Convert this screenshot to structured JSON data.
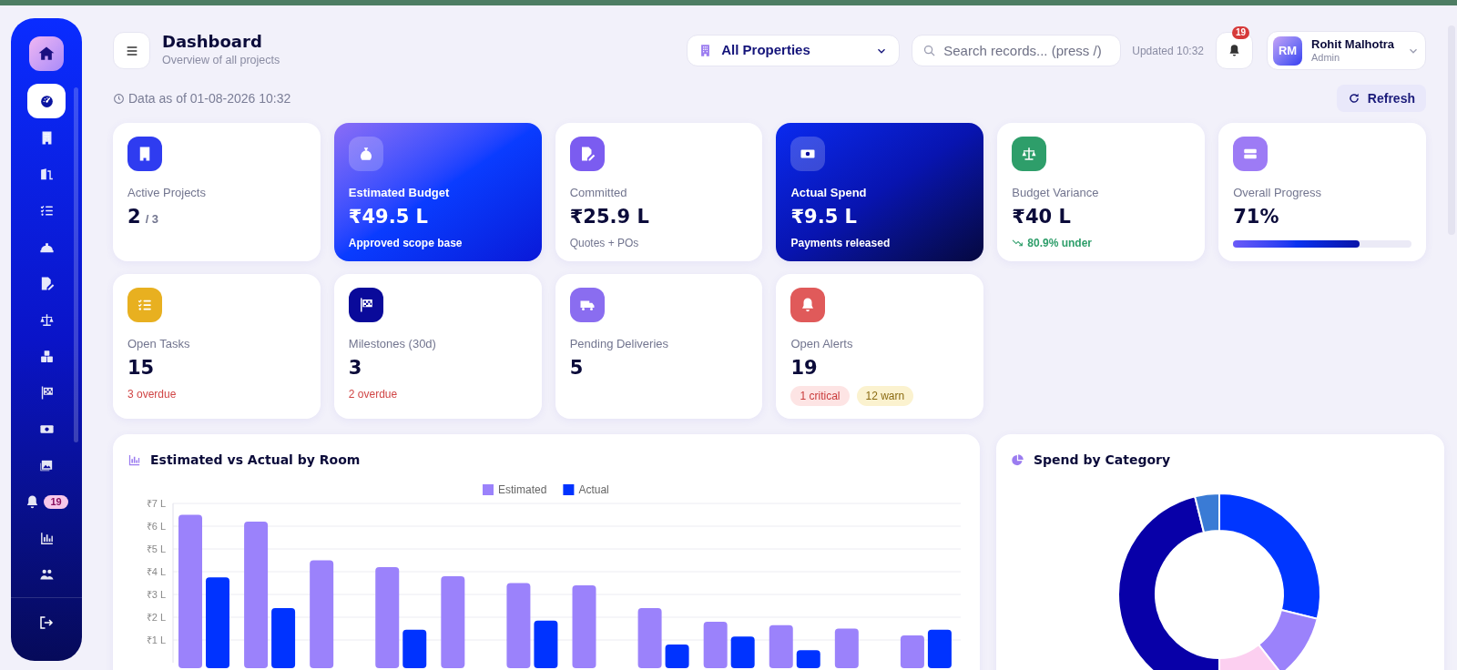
{
  "sidebar": {
    "items": [
      {
        "selected": true
      },
      {
        "selected": false
      },
      {
        "selected": false
      },
      {
        "selected": false
      },
      {
        "selected": false
      },
      {
        "selected": false
      },
      {
        "selected": false
      },
      {
        "selected": false
      },
      {
        "selected": false
      },
      {
        "selected": false
      },
      {
        "selected": false
      },
      {
        "selected": false,
        "badge": "19"
      },
      {
        "selected": false
      },
      {
        "selected": false
      }
    ]
  },
  "header": {
    "title": "Dashboard",
    "subtitle": "Overview of all projects",
    "property_select": {
      "value": "All Properties"
    },
    "search": {
      "placeholder": "Search records... (press /)"
    },
    "updated": "Updated 10:32",
    "notifications": {
      "count": "19"
    },
    "user": {
      "initials": "RM",
      "name": "Rohit Malhotra",
      "role": "Admin"
    }
  },
  "data_as_of": "Data as of 01-08-2026 10:32",
  "refresh_button": "Refresh",
  "kpi_cards": [
    {
      "kind": "plain",
      "label": "Active Projects",
      "value": "2",
      "value_suffix": "/ 3",
      "color": "#2f3cf0"
    },
    {
      "kind": "highlight",
      "label": "Estimated Budget",
      "value": "₹49.5 L",
      "note": {
        "text": "Approved scope base",
        "kind": "default"
      }
    },
    {
      "kind": "plain",
      "label": "Committed",
      "value": "₹25.9 L",
      "note": {
        "text": "Quotes + POs",
        "kind": "muted"
      },
      "color": "#7b5cf0"
    },
    {
      "kind": "dark",
      "label": "Actual Spend",
      "value": "₹9.5 L",
      "note": {
        "text": "Payments released",
        "kind": "default"
      }
    },
    {
      "kind": "plain",
      "label": "Budget Variance",
      "value": "₹40 L",
      "note": {
        "text": "80.9% under",
        "kind": "positive"
      },
      "color": "#2e9e6a"
    },
    {
      "kind": "progress",
      "label": "Overall Progress",
      "value": "71%",
      "level": 0.71,
      "color": "#9d7bf5"
    },
    {
      "kind": "plain",
      "label": "Open Tasks",
      "value": "15",
      "note": {
        "text": "3 overdue",
        "kind": "negative"
      },
      "color": "#e8b020"
    },
    {
      "kind": "plain",
      "label": "Milestones (30d)",
      "value": "3",
      "note": {
        "text": "2 overdue",
        "kind": "negative"
      },
      "color": "#0a0a9a"
    },
    {
      "kind": "plain",
      "label": "Pending Deliveries",
      "value": "5",
      "color": "#8a6df0"
    },
    {
      "kind": "plain",
      "label": "Open Alerts",
      "value": "19",
      "color": "#e05a5a",
      "tags": [
        {
          "kind": "critical",
          "text": "1 critical"
        },
        {
          "kind": "warn",
          "text": "12 warn"
        }
      ]
    }
  ],
  "charts": [
    {
      "title": "Estimated vs Actual by Room",
      "chart_data": {
        "type": "bar",
        "grid": true,
        "legend": true,
        "ylim": [
          0,
          7
        ],
        "yticks": [
          {
            "value": 1,
            "label": "₹1 L"
          },
          {
            "value": 2,
            "label": "₹2 L"
          },
          {
            "value": 3,
            "label": "₹3 L"
          },
          {
            "value": 4,
            "label": "₹4 L"
          },
          {
            "value": 5,
            "label": "₹5 L"
          },
          {
            "value": 6,
            "label": "₹6 L"
          },
          {
            "value": 7,
            "label": "₹7 L"
          }
        ],
        "series": [
          {
            "name": "Estimated",
            "color": "#9b82fb",
            "values": [
              6.5,
              6.2,
              4.5,
              4.2,
              3.8,
              3.5,
              3.4,
              2.4,
              1.8,
              1.65,
              1.5,
              1.2
            ]
          },
          {
            "name": "Actual",
            "color": "#0033ff",
            "values": [
              3.75,
              2.4,
              0,
              1.45,
              0,
              1.85,
              0,
              0.8,
              1.15,
              0.55,
              0,
              1.45
            ]
          }
        ]
      }
    },
    {
      "title": "Spend by Category"
    }
  ]
}
